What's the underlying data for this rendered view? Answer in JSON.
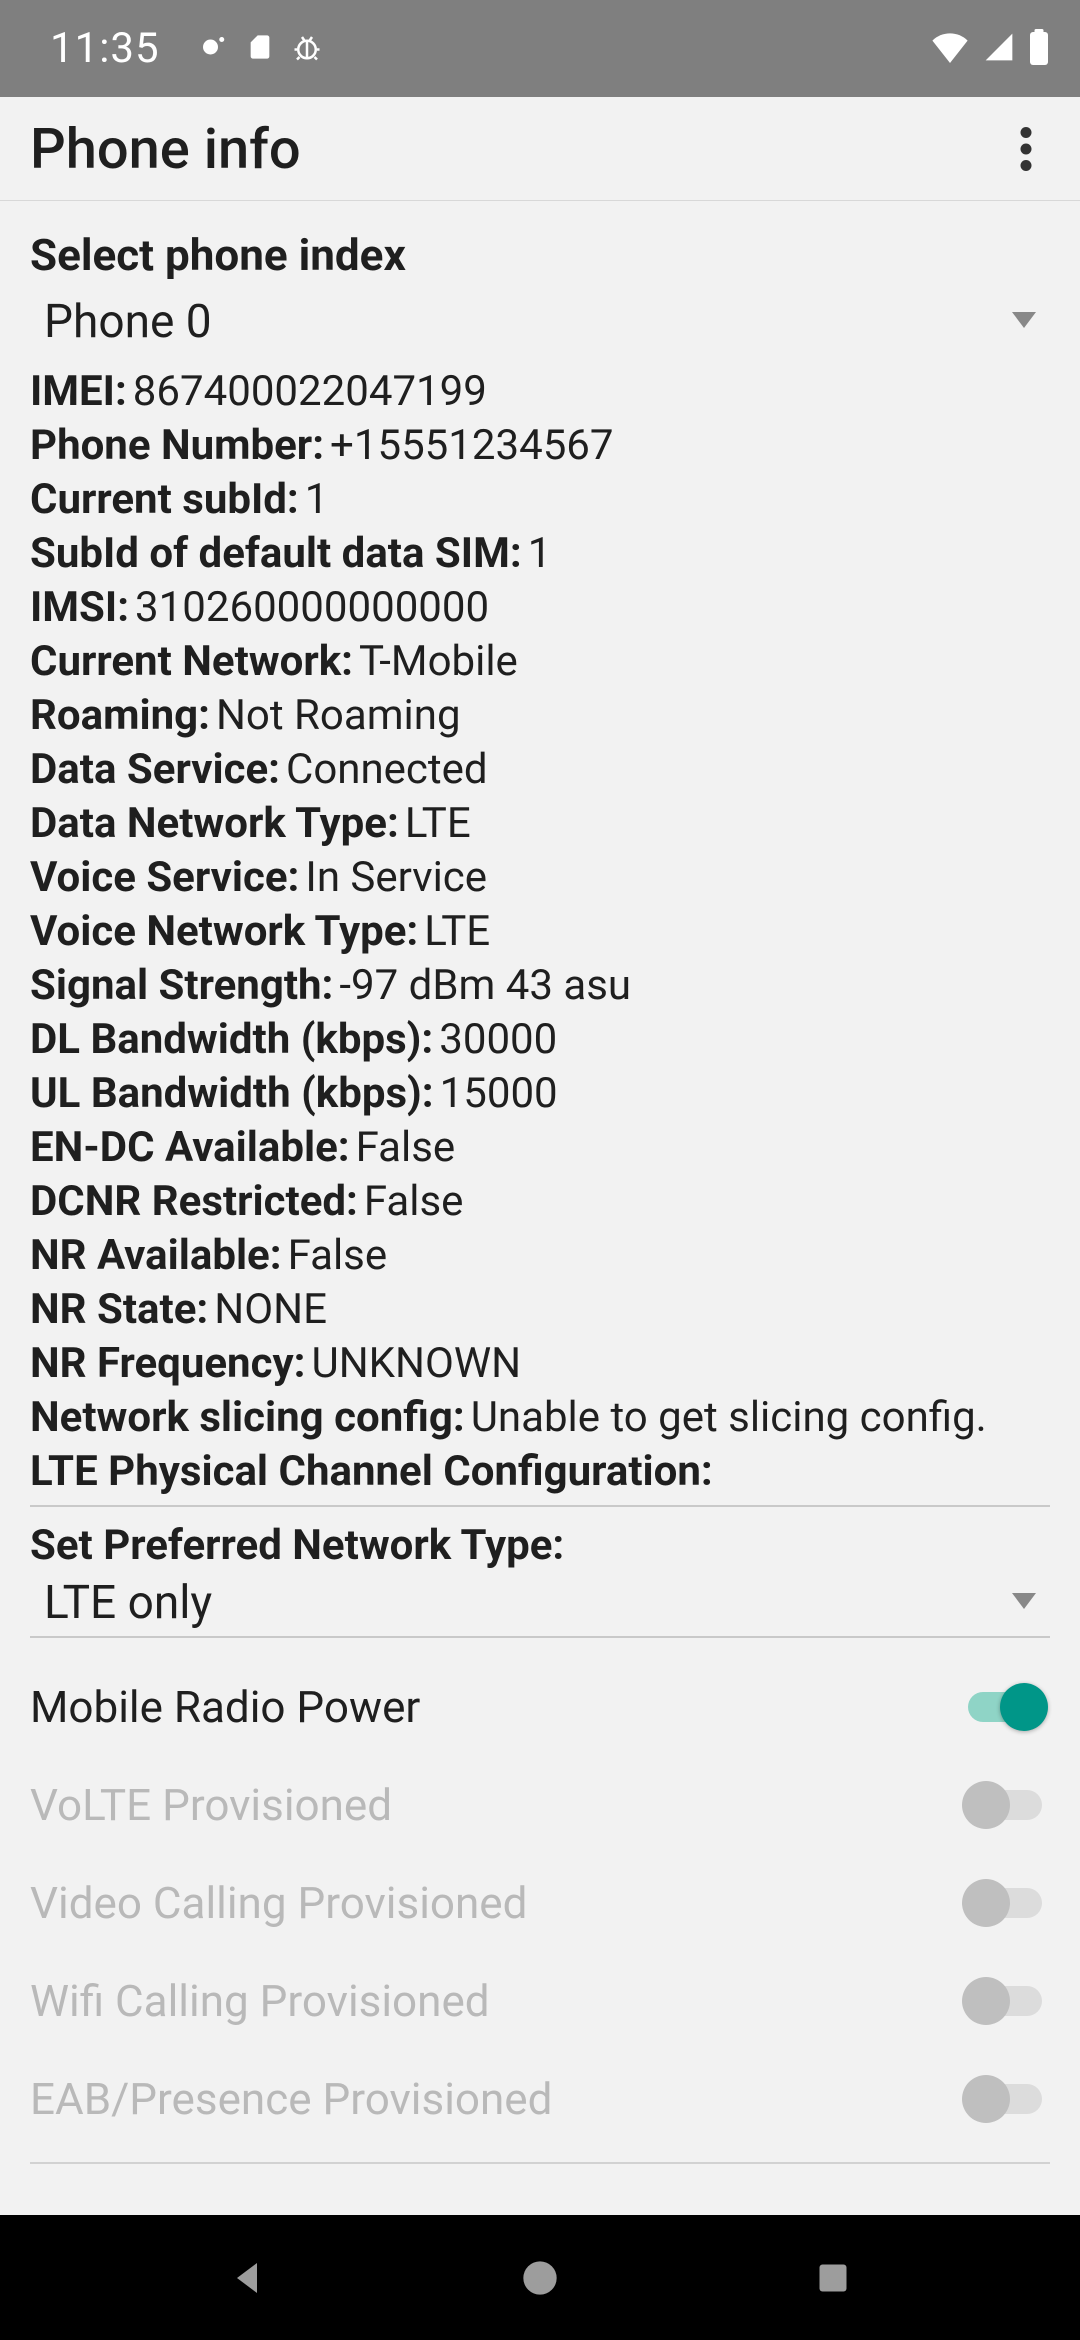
{
  "statusBar": {
    "time": "11:35"
  },
  "appBar": {
    "title": "Phone info"
  },
  "phoneIndex": {
    "title": "Select phone index",
    "selected": "Phone 0"
  },
  "info": [
    {
      "label": "IMEI:",
      "value": "867400022047199"
    },
    {
      "label": "Phone Number:",
      "value": "+15551234567"
    },
    {
      "label": "Current subId:",
      "value": "1"
    },
    {
      "label": "SubId of default data SIM:",
      "value": "1"
    },
    {
      "label": "IMSI:",
      "value": "310260000000000"
    },
    {
      "label": "Current Network:",
      "value": "T-Mobile"
    },
    {
      "label": "Roaming:",
      "value": "Not Roaming"
    },
    {
      "label": "Data Service:",
      "value": "Connected"
    },
    {
      "label": "Data Network Type:",
      "value": "LTE"
    },
    {
      "label": "Voice Service:",
      "value": "In Service"
    },
    {
      "label": "Voice Network Type:",
      "value": "LTE"
    },
    {
      "label": "Signal Strength:",
      "value": "-97 dBm   43 asu"
    },
    {
      "label": "DL Bandwidth (kbps):",
      "value": "30000"
    },
    {
      "label": "UL Bandwidth (kbps):",
      "value": "15000"
    },
    {
      "label": "EN-DC Available:",
      "value": "False"
    },
    {
      "label": "DCNR Restricted:",
      "value": "False"
    },
    {
      "label": "NR Available:",
      "value": "False"
    },
    {
      "label": "NR State:",
      "value": "NONE"
    },
    {
      "label": "NR Frequency:",
      "value": "UNKNOWN"
    },
    {
      "label": "Network slicing config:",
      "value": "Unable to get slicing config."
    },
    {
      "label": "LTE Physical Channel Configuration:",
      "value": ""
    }
  ],
  "prefNetwork": {
    "title": "Set Preferred Network Type:",
    "selected": "LTE only"
  },
  "toggles": [
    {
      "label": "Mobile Radio Power",
      "on": true,
      "disabled": false
    },
    {
      "label": "VoLTE Provisioned",
      "on": false,
      "disabled": true
    },
    {
      "label": "Video Calling Provisioned",
      "on": false,
      "disabled": true
    },
    {
      "label": "Wifi Calling Provisioned",
      "on": false,
      "disabled": true
    },
    {
      "label": "EAB/Presence Provisioned",
      "on": false,
      "disabled": true
    }
  ]
}
